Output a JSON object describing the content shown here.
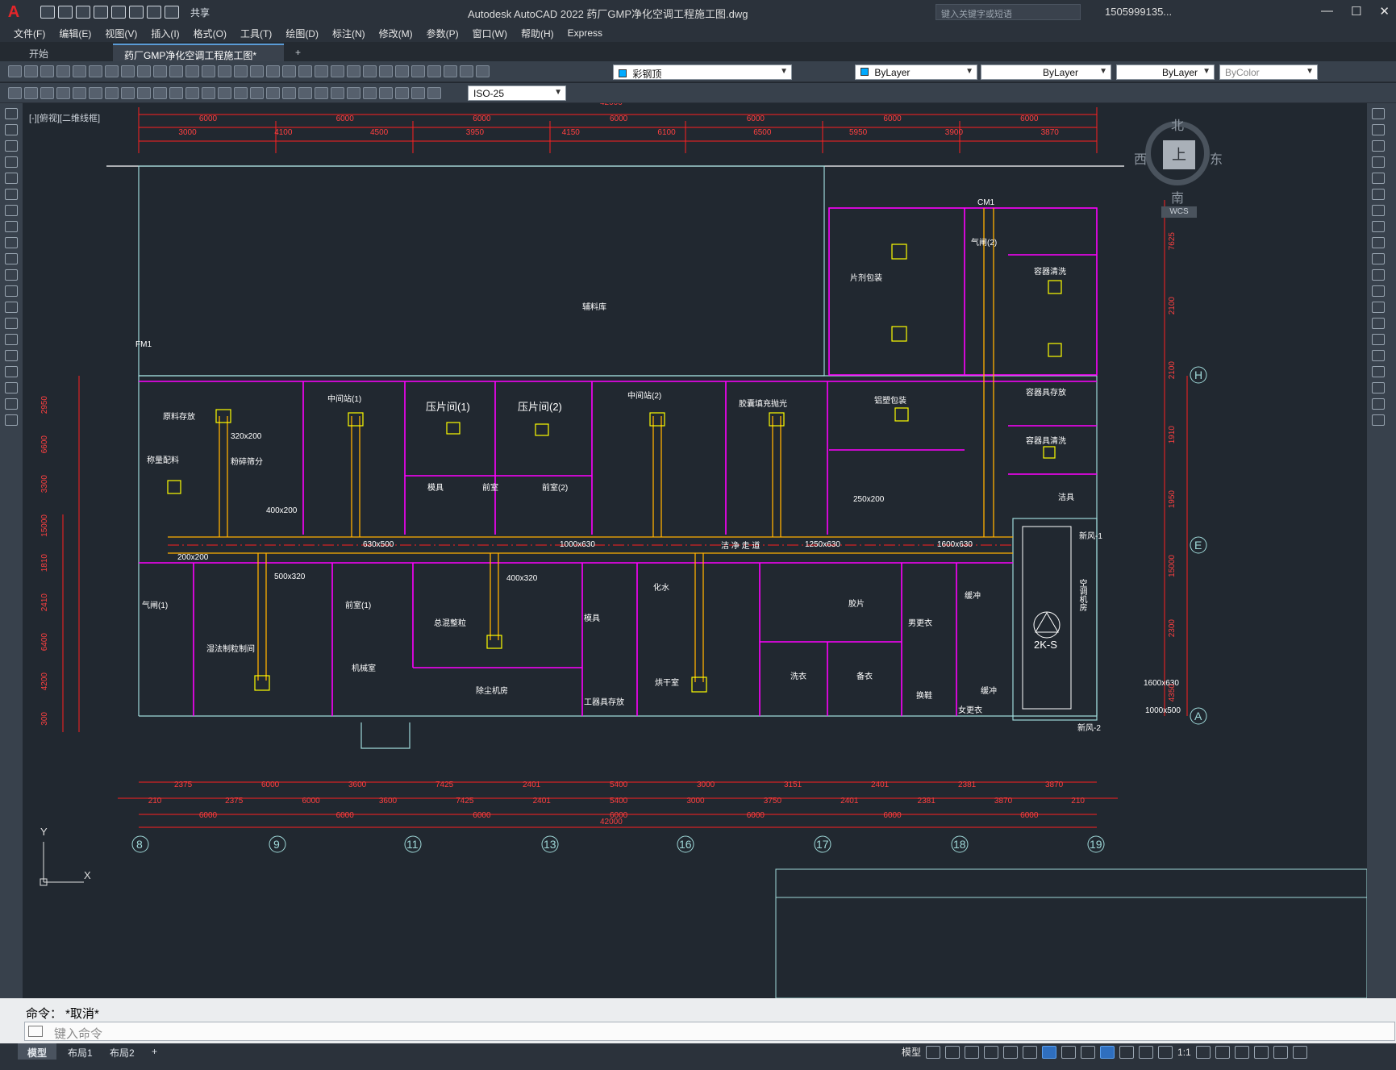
{
  "app": {
    "logo": "A",
    "title": "Autodesk AutoCAD 2022    药厂GMP净化空调工程施工图.dwg",
    "share_label": "共享",
    "search_placeholder": "键入关键字或短语",
    "user": "1505999135...",
    "window_buttons": [
      "—",
      "☐",
      "✕"
    ]
  },
  "menu": [
    "文件(F)",
    "编辑(E)",
    "视图(V)",
    "插入(I)",
    "格式(O)",
    "工具(T)",
    "绘图(D)",
    "标注(N)",
    "修改(M)",
    "参数(P)",
    "窗口(W)",
    "帮助(H)",
    "Express"
  ],
  "tabs": {
    "start": "开始",
    "doc": "药厂GMP净化空调工程施工图*",
    "add": "+"
  },
  "toolbar": {
    "layer": "彩钢顶",
    "color": "ByLayer",
    "linetype": "ByLayer",
    "lineweight": "ByLayer",
    "plotstyle": "ByColor",
    "dimstyle": "ISO-25"
  },
  "canvas": {
    "view_label": "[-][俯视][二维线框]",
    "viewcube": {
      "north": "北",
      "south": "南",
      "east": "东",
      "west": "西",
      "top": "上",
      "wcs": "WCS"
    },
    "ucs": {
      "x": "X",
      "y": "Y"
    }
  },
  "drawing": {
    "total_dim": "42000",
    "top_dims_row1": [
      "6000",
      "6000",
      "6000",
      "6000",
      "6000",
      "6000",
      "6000"
    ],
    "top_dims_row2": [
      "3000",
      "4100",
      "4500",
      "3950",
      "4150",
      "6100",
      "6500",
      "5950",
      "3900",
      "3870"
    ],
    "bottom_dims_row1": [
      "2375",
      "6000",
      "3600",
      "7425",
      "2401",
      "5400",
      "3000",
      "3151",
      "2401",
      "2381",
      "3870"
    ],
    "bottom_dims_row2": [
      "210",
      "2375",
      "6000",
      "3600",
      "7425",
      "2401",
      "5400",
      "3000",
      "3750",
      "2401",
      "2381",
      "3870",
      "210"
    ],
    "bottom_dims_row3": [
      "6000",
      "6000",
      "6000",
      "6000",
      "6000",
      "6000",
      "6000"
    ],
    "grid_bottom": [
      "8",
      "9",
      "11",
      "13",
      "16",
      "17",
      "18",
      "19"
    ],
    "grid_right": [
      "H",
      "E",
      "A"
    ],
    "left_dims": [
      "2950",
      "6600",
      "3300",
      "15000",
      "1810",
      "2410",
      "6400",
      "4200",
      "300"
    ],
    "right_dims": [
      "7625",
      "2100",
      "2100",
      "1910",
      "1950",
      "15000",
      "2300",
      "4350"
    ],
    "rooms": [
      {
        "label": "辅料库",
        "color": "#ffffff"
      },
      {
        "label": "片剂包装",
        "color": "#ffffff"
      },
      {
        "label": "CM1",
        "color": "#ffffff"
      },
      {
        "label": "FM1",
        "color": "#ffffff"
      },
      {
        "label": "气闸(2)",
        "color": "#ffffff"
      },
      {
        "label": "容器清洗",
        "color": "#ffffff"
      },
      {
        "label": "原料存放",
        "color": "#ffffff"
      },
      {
        "label": "中间站(1)",
        "color": "#ffffff"
      },
      {
        "label": "压片间(1)",
        "color": "#ffffff"
      },
      {
        "label": "压片间(2)",
        "color": "#ffffff"
      },
      {
        "label": "中间站(2)",
        "color": "#ffffff"
      },
      {
        "label": "胶囊填充抛光",
        "color": "#ffffff"
      },
      {
        "label": "铝塑包装",
        "color": "#ffffff"
      },
      {
        "label": "容器具存放",
        "color": "#ffffff"
      },
      {
        "label": "容器具清洗",
        "color": "#ffffff"
      },
      {
        "label": "称量配料",
        "color": "#ffffff"
      },
      {
        "label": "粉碎筛分",
        "color": "#ffffff"
      },
      {
        "label": "模具",
        "color": "#ffffff"
      },
      {
        "label": "前室",
        "color": "#ffffff"
      },
      {
        "label": "前室(2)",
        "color": "#ffffff"
      },
      {
        "label": "洁具",
        "color": "#ffffff"
      },
      {
        "label": "洁 净 走 道",
        "color": "#ffffff"
      },
      {
        "label": "气闸(1)",
        "color": "#ffffff"
      },
      {
        "label": "前室(1)",
        "color": "#ffffff"
      },
      {
        "label": "总混整粒",
        "color": "#ffffff"
      },
      {
        "label": "模具",
        "color": "#ffffff"
      },
      {
        "label": "化水",
        "color": "#ffffff"
      },
      {
        "label": "胶片",
        "color": "#ffffff"
      },
      {
        "label": "男更衣",
        "color": "#ffffff"
      },
      {
        "label": "缓冲",
        "color": "#ffffff"
      },
      {
        "label": "湿法制粒制间",
        "color": "#ffffff"
      },
      {
        "label": "机械室",
        "color": "#ffffff"
      },
      {
        "label": "除尘机房",
        "color": "#ffffff"
      },
      {
        "label": "工器具存放",
        "color": "#ffffff"
      },
      {
        "label": "烘干室",
        "color": "#ffffff"
      },
      {
        "label": "洗衣",
        "color": "#ffffff"
      },
      {
        "label": "备衣",
        "color": "#ffffff"
      },
      {
        "label": "换鞋",
        "color": "#ffffff"
      },
      {
        "label": "女更衣",
        "color": "#ffffff"
      },
      {
        "label": "缓冲",
        "color": "#ffffff"
      },
      {
        "label": "空调机房",
        "color": "#ffffff"
      }
    ],
    "ducts": [
      {
        "label": "630x500"
      },
      {
        "label": "1000x630"
      },
      {
        "label": "1250x630"
      },
      {
        "label": "1600x630"
      },
      {
        "label": "320x200"
      },
      {
        "label": "400x200"
      },
      {
        "label": "500x320"
      },
      {
        "label": "400x320"
      },
      {
        "label": "200x200"
      },
      {
        "label": "250x200"
      },
      {
        "label": "1600x630"
      },
      {
        "label": "1000x500"
      }
    ],
    "ahu_label": "2K-S",
    "ahu_tags": [
      "新风-1",
      "新风-2"
    ]
  },
  "command": {
    "history": "命令： *取消*",
    "placeholder": "键入命令"
  },
  "status": {
    "tabs": [
      "模型",
      "布局1",
      "布局2",
      "+"
    ],
    "model_label": "模型",
    "scale": "1:1"
  },
  "colors": {
    "accent": "#5a9bd6",
    "magenta": "#ff00ff",
    "red": "#ff2020",
    "yellow": "#ffff00",
    "cyan": "#00ffff",
    "white": "#ffffff"
  }
}
